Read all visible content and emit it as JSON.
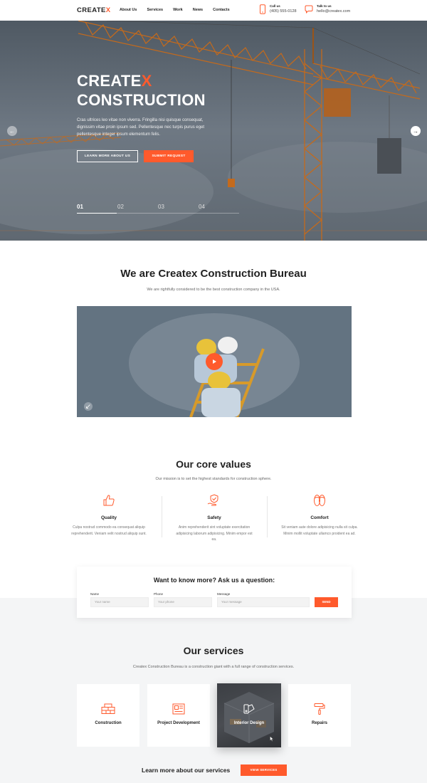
{
  "header": {
    "logo": {
      "main": "CREATE",
      "accent": "X"
    },
    "nav": [
      "About Us",
      "Services",
      "Work",
      "News",
      "Contacts"
    ],
    "call": {
      "label": "Call us",
      "value": "(405) 555-0128"
    },
    "talk": {
      "label": "Talk to us",
      "value": "hello@createx.com"
    }
  },
  "hero": {
    "title_line1_main": "CREATE",
    "title_line1_accent": "X",
    "title_line2": "CONSTRUCTION",
    "text": "Cras ultrices leo vitae non viverra. Fringilla nisi quisque consequat, dignissim vitae proin ipsum sed. Pellentesque nec turpis purus eget pellentesque integer ipsum elementum felis.",
    "btn_learn": "LEARN MORE ABOUT US",
    "btn_submit": "SUBMIT REQUEST",
    "slides": [
      "01",
      "02",
      "03",
      "04"
    ],
    "active_slide": "01"
  },
  "about": {
    "title": "We are Createx Construction Bureau",
    "subtitle": "We are rightfully considered to be the best construction company in the USA."
  },
  "values": {
    "title": "Our core values",
    "subtitle": "Our mission is to set the highest standards for construction sphere.",
    "items": [
      {
        "icon": "thumbs-up-icon",
        "title": "Quality",
        "text": "Culpa nostrud commodo ea consequat aliquip reprehenderit. Veniam velit nostrud aliquip sunt."
      },
      {
        "icon": "hand-shield-icon",
        "title": "Safety",
        "text": "Anim reprehenderit sint voluptate exercitation adipisicing laborum adipisicing. Minim empor est ea."
      },
      {
        "icon": "slippers-icon",
        "title": "Comfort",
        "text": "Sit veniam aute dolore adipisicing nulla sit culpa. Minim mollit voluptate ullamco proident ea ad."
      }
    ]
  },
  "form": {
    "title": "Want to know more? Ask us a question:",
    "name_label": "Name",
    "name_placeholder": "Your name",
    "phone_label": "Phone",
    "phone_placeholder": "Your phone",
    "message_label": "Message",
    "message_placeholder": "Your message",
    "send": "SEND"
  },
  "services": {
    "title": "Our services",
    "subtitle": "Createx Construction Bureau is a construction giant with a full range of construction services.",
    "items": [
      {
        "icon": "bricks-icon",
        "label": "Construction"
      },
      {
        "icon": "blueprint-icon",
        "label": "Project Development"
      },
      {
        "icon": "color-palette-icon",
        "label": "Interior Design"
      },
      {
        "icon": "paint-roller-icon",
        "label": "Repairs"
      }
    ],
    "learn_text": "Learn more about our services",
    "view_btn": "VIEW SERVICES"
  },
  "colors": {
    "accent": "#ff5a2c",
    "dark": "#222222"
  }
}
